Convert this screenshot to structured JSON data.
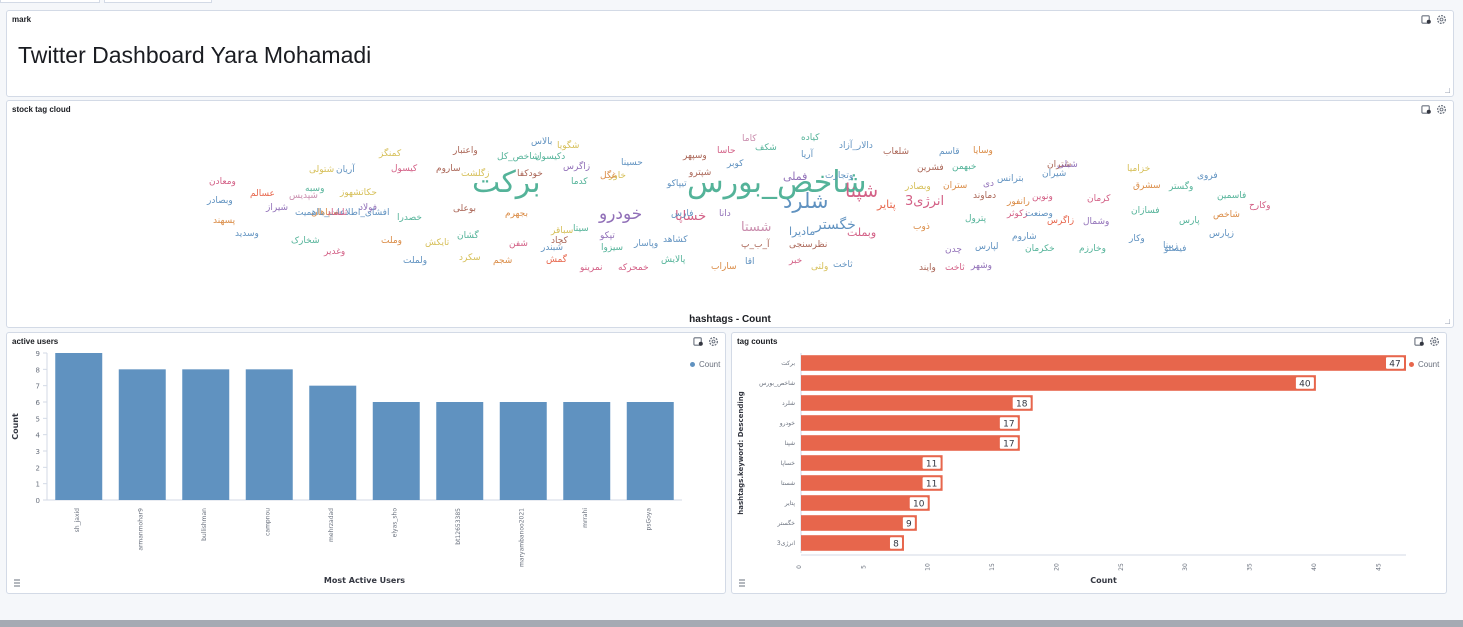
{
  "markdown_panel": {
    "title": "mark",
    "heading": "Twitter Dashboard Yara Mohamadi"
  },
  "cloud_panel": {
    "title": "stock tag cloud",
    "caption": "hashtags - Count",
    "words": [
      {
        "t": "برکت",
        "c": "#54b399",
        "s": 30
      },
      {
        "t": "شاخص_بورس",
        "c": "#54b399",
        "s": 30
      },
      {
        "t": "شلرد",
        "c": "#6092c0",
        "s": 21
      },
      {
        "t": "شپنا",
        "c": "#d36086",
        "s": 19
      },
      {
        "t": "خودرو",
        "c": "#9170b8",
        "s": 17
      },
      {
        "t": "خگستر",
        "c": "#6092c0",
        "s": 14
      },
      {
        "t": "انرژی3",
        "c": "#d36086",
        "s": 13
      },
      {
        "t": "خساپا",
        "c": "#d36086",
        "s": 13
      },
      {
        "t": "شستا",
        "c": "#ca8eae",
        "s": 13
      },
      {
        "t": "وبملت",
        "c": "#d36086",
        "s": 11
      },
      {
        "t": "ماديرا",
        "c": "#6092c0",
        "s": 11
      },
      {
        "t": "پتاير",
        "c": "#e7664c",
        "s": 11
      },
      {
        "t": "فملی",
        "c": "#9170b8",
        "s": 11
      },
      {
        "t": "شگویا",
        "c": "#d6bf57",
        "s": 9
      },
      {
        "t": "وسایا",
        "c": "#da8b45",
        "s": 9
      },
      {
        "t": "واعتبار",
        "c": "#aa6556",
        "s": 9
      },
      {
        "t": "کمنگز",
        "c": "#d6bf57",
        "s": 9
      },
      {
        "t": "آریا",
        "c": "#6092c0",
        "s": 9
      },
      {
        "t": "کدما",
        "c": "#54b399",
        "s": 9
      },
      {
        "t": "بجهرم",
        "c": "#da8b45",
        "s": 9
      },
      {
        "t": "سپاهان",
        "c": "#da8b45",
        "s": 9
      },
      {
        "t": "خصدرا",
        "c": "#54b399",
        "s": 9
      },
      {
        "t": "فولاد",
        "c": "#9170b8",
        "s": 9
      },
      {
        "t": "عسالم",
        "c": "#e7664c",
        "s": 9
      },
      {
        "t": "وبصادر",
        "c": "#6092c0",
        "s": 9
      },
      {
        "t": "ومعادن",
        "c": "#d36086",
        "s": 9
      },
      {
        "t": "شیراز",
        "c": "#9170b8",
        "s": 9
      },
      {
        "t": "تیپاکو",
        "c": "#6092c0",
        "s": 9
      },
      {
        "t": "ذوب",
        "c": "#da8b45",
        "s": 9
      },
      {
        "t": "وبصادر",
        "c": "#d6bf57",
        "s": 9
      },
      {
        "t": "گمش",
        "c": "#e7664c",
        "s": 9
      },
      {
        "t": "کاما",
        "c": "#ca8eae",
        "s": 9
      },
      {
        "t": "خاور",
        "c": "#d6bf57",
        "s": 9
      },
      {
        "t": "کچاد",
        "c": "#aa6556",
        "s": 9
      },
      {
        "t": "شپدیس",
        "c": "#ca8eae",
        "s": 9
      },
      {
        "t": "شخارک",
        "c": "#54b399",
        "s": 9
      },
      {
        "t": "فارس",
        "c": "#6092c0",
        "s": 9
      },
      {
        "t": "دی",
        "c": "#9170b8",
        "s": 9
      },
      {
        "t": "شپترو",
        "c": "#aa6556",
        "s": 9
      },
      {
        "t": "وسپهر",
        "c": "#aa6556",
        "s": 9
      },
      {
        "t": "حسینا",
        "c": "#6092c0",
        "s": 9
      },
      {
        "t": "غگل",
        "c": "#da8b45",
        "s": 9
      },
      {
        "t": "حاسا",
        "c": "#d36086",
        "s": 9
      },
      {
        "t": "خودکفا",
        "c": "#aa6556",
        "s": 9
      },
      {
        "t": "زاگرس",
        "c": "#9170b8",
        "s": 9
      },
      {
        "t": "بالاس",
        "c": "#6092c0",
        "s": 9
      },
      {
        "t": "کوبر",
        "c": "#6092c0",
        "s": 9
      },
      {
        "t": "زگلشت",
        "c": "#d6bf57",
        "s": 9
      },
      {
        "t": "شاخص_کل",
        "c": "#54b399",
        "s": 9
      },
      {
        "t": "دکیسول",
        "c": "#54b399",
        "s": 9
      },
      {
        "t": "کیسول",
        "c": "#d36086",
        "s": 9
      },
      {
        "t": "ساروم",
        "c": "#aa6556",
        "s": 9
      },
      {
        "t": "آریان",
        "c": "#6092c0",
        "s": 9
      },
      {
        "t": "شتولی",
        "c": "#d6bf57",
        "s": 9
      },
      {
        "t": "وسبه",
        "c": "#54b399",
        "s": 9
      },
      {
        "t": "حکاتشهوز",
        "c": "#d6bf57",
        "s": 9
      },
      {
        "t": "افشای_اطلاعات_بااهمیت",
        "c": "#6092c0",
        "s": 9
      },
      {
        "t": "تلشاد",
        "c": "#d36086",
        "s": 9
      },
      {
        "t": "پسهند",
        "c": "#da8b45",
        "s": 9
      },
      {
        "t": "وسدید",
        "c": "#6092c0",
        "s": 9
      },
      {
        "t": "وغدیر",
        "c": "#d36086",
        "s": 9
      },
      {
        "t": "ولملت",
        "c": "#6092c0",
        "s": 9
      },
      {
        "t": "وملت",
        "c": "#da8b45",
        "s": 9
      },
      {
        "t": "تایکش",
        "c": "#d6bf57",
        "s": 9
      },
      {
        "t": "بوعلی",
        "c": "#aa6556",
        "s": 9
      },
      {
        "t": "گشان",
        "c": "#54b399",
        "s": 9
      },
      {
        "t": "سکرد",
        "c": "#d6bf57",
        "s": 9
      },
      {
        "t": "شجم",
        "c": "#da8b45",
        "s": 9
      },
      {
        "t": "شفن",
        "c": "#d36086",
        "s": 9
      },
      {
        "t": "شبندر",
        "c": "#6092c0",
        "s": 9
      },
      {
        "t": "سیتا",
        "c": "#54b399",
        "s": 9
      },
      {
        "t": "سباقر",
        "c": "#d6bf57",
        "s": 9
      },
      {
        "t": "تپکو",
        "c": "#9170b8",
        "s": 9
      },
      {
        "t": "وپاسار",
        "c": "#6092c0",
        "s": 9
      },
      {
        "t": "سیزوا",
        "c": "#54b399",
        "s": 9
      },
      {
        "t": "کشاهد",
        "c": "#6092c0",
        "s": 9
      },
      {
        "t": "پالایش",
        "c": "#54b399",
        "s": 9
      },
      {
        "t": "خمحرکه",
        "c": "#d36086",
        "s": 9
      },
      {
        "t": "نمرینو",
        "c": "#d36086",
        "s": 9
      },
      {
        "t": "ساراب",
        "c": "#da8b45",
        "s": 9
      },
      {
        "t": "اقا",
        "c": "#6092c0",
        "s": 9
      },
      {
        "t": "خبر",
        "c": "#d36086",
        "s": 9
      },
      {
        "t": "ولتی",
        "c": "#d6bf57",
        "s": 9
      },
      {
        "t": "ثاخت",
        "c": "#6092c0",
        "s": 9
      },
      {
        "t": "وتجارت",
        "c": "#6092c0",
        "s": 9
      },
      {
        "t": "دالار_آزاد",
        "c": "#6092c0",
        "s": 9
      },
      {
        "t": "کیاده",
        "c": "#54b399",
        "s": 9
      },
      {
        "t": "شکف",
        "c": "#54b399",
        "s": 9
      },
      {
        "t": "نظرسنجی",
        "c": "#aa6556",
        "s": 9
      },
      {
        "t": "آ_ب_پ",
        "c": "#aa6556",
        "s": 9
      },
      {
        "t": "دانا",
        "c": "#9170b8",
        "s": 9
      },
      {
        "t": "شلعاب",
        "c": "#aa6556",
        "s": 9
      },
      {
        "t": "قاسم",
        "c": "#6092c0",
        "s": 9
      },
      {
        "t": "خبهمن",
        "c": "#54b399",
        "s": 9
      },
      {
        "t": "فشرین",
        "c": "#aa6556",
        "s": 9
      },
      {
        "t": "ستران",
        "c": "#da8b45",
        "s": 9
      },
      {
        "t": "دماوند",
        "c": "#aa6556",
        "s": 9
      },
      {
        "t": "رانفور",
        "c": "#da8b45",
        "s": 9
      },
      {
        "t": "زکوثر",
        "c": "#d36086",
        "s": 9
      },
      {
        "t": "پترول",
        "c": "#54b399",
        "s": 9
      },
      {
        "t": "چدن",
        "c": "#9170b8",
        "s": 9
      },
      {
        "t": "لپارس",
        "c": "#6092c0",
        "s": 9
      },
      {
        "t": "ثاخت",
        "c": "#d36086",
        "s": 9
      },
      {
        "t": "وایند",
        "c": "#aa6556",
        "s": 9
      },
      {
        "t": "وشهر",
        "c": "#9170b8",
        "s": 9
      },
      {
        "t": "شاروم",
        "c": "#6092c0",
        "s": 9
      },
      {
        "t": "وصنعت",
        "c": "#6092c0",
        "s": 9
      },
      {
        "t": "ونوین",
        "c": "#d36086",
        "s": 9
      },
      {
        "t": "بترانس",
        "c": "#6092c0",
        "s": 9
      },
      {
        "t": "شیران",
        "c": "#6092c0",
        "s": 9
      },
      {
        "t": "شتران",
        "c": "#aa6556",
        "s": 9
      },
      {
        "t": "شبلی",
        "c": "#9170b8",
        "s": 9
      },
      {
        "t": "زاگرس",
        "c": "#e7664c",
        "s": 9
      },
      {
        "t": "خکرمان",
        "c": "#54b399",
        "s": 9
      },
      {
        "t": "وخارزم",
        "c": "#54b399",
        "s": 9
      },
      {
        "t": "وشمال",
        "c": "#9170b8",
        "s": 9
      },
      {
        "t": "کرمان",
        "c": "#d36086",
        "s": 9
      },
      {
        "t": "فسازان",
        "c": "#54b399",
        "s": 9
      },
      {
        "t": "خزامیا",
        "c": "#d6bf57",
        "s": 9
      },
      {
        "t": "سشرق",
        "c": "#da8b45",
        "s": 9
      },
      {
        "t": "وگستر",
        "c": "#54b399",
        "s": 9
      },
      {
        "t": "فروی",
        "c": "#6092c0",
        "s": 9
      },
      {
        "t": "فاسمین",
        "c": "#54b399",
        "s": 9
      },
      {
        "t": "شاخص",
        "c": "#da8b45",
        "s": 9
      },
      {
        "t": "پارس",
        "c": "#54b399",
        "s": 9
      },
      {
        "t": "وکارح",
        "c": "#d36086",
        "s": 9
      },
      {
        "t": "زپارس",
        "c": "#6092c0",
        "s": 9
      },
      {
        "t": "وکار",
        "c": "#6092c0",
        "s": 9
      },
      {
        "t": "زبینا",
        "c": "#6092c0",
        "s": 9
      },
      {
        "t": "فیستو",
        "c": "#6092c0",
        "s": 9
      }
    ]
  },
  "users_panel": {
    "title": "active users",
    "legend": "Count",
    "color": "#6092c0"
  },
  "tags_panel": {
    "title": "tag counts",
    "legend": "Count",
    "color": "#e7664c"
  },
  "chart_data": [
    {
      "type": "bar",
      "categories": [
        "sh_jaxid",
        "armanmohar9",
        "bullishman",
        "campnou",
        "mehrzadad",
        "elyas_sho",
        "bt12653385",
        "maryambanoo2021",
        "mrrahi",
        "psGoya"
      ],
      "series": [
        {
          "name": "Count",
          "values": [
            9,
            8,
            8,
            8,
            7,
            6,
            6,
            6,
            6,
            6
          ]
        }
      ],
      "xlabel": "Most Active Users",
      "ylabel": "Count",
      "ylim": [
        0,
        9
      ],
      "yticks": [
        0,
        1,
        2,
        3,
        4,
        5,
        6,
        7,
        8,
        9
      ],
      "legend": "top-right"
    },
    {
      "type": "bar",
      "orientation": "horizontal",
      "categories": [
        "برکت",
        "شاخص_بورس",
        "شلرد",
        "خودرو",
        "شپنا",
        "خساپا",
        "شستا",
        "پتاير",
        "خگستر",
        "انرژی3"
      ],
      "series": [
        {
          "name": "Count",
          "values": [
            47,
            40,
            18,
            17,
            17,
            11,
            11,
            10,
            9,
            8
          ]
        }
      ],
      "xlabel": "Count",
      "ylabel": "hashtags.keyword: Descending",
      "xlim": [
        0,
        47
      ],
      "xticks": [
        0,
        5,
        10,
        15,
        20,
        25,
        30,
        35,
        40,
        45
      ],
      "legend": "top-right"
    }
  ]
}
